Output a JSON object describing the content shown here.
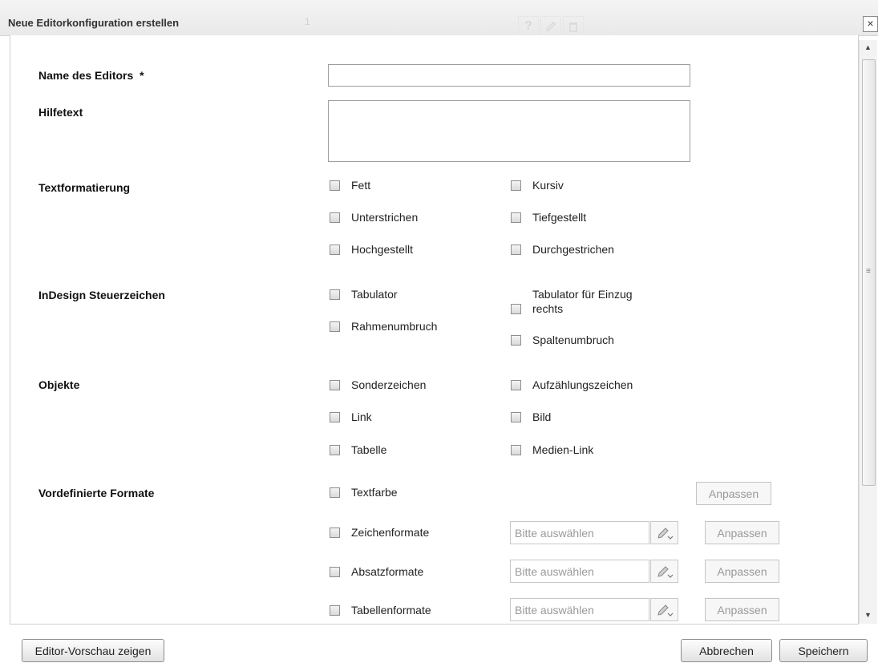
{
  "dialog": {
    "title": "Neue Editorkonfiguration erstellen",
    "bg_number": "1",
    "close_symbol": "×"
  },
  "form": {
    "name_label": "Name des Editors",
    "required_mark": "*",
    "name_value": "",
    "help_label": "Hilfetext",
    "help_value": "",
    "textformat": {
      "label": "Textformatierung",
      "options": [
        "Fett",
        "Kursiv",
        "Unterstrichen",
        "Tiefgestellt",
        "Hochgestellt",
        "Durchgestrichen"
      ]
    },
    "indesign": {
      "label": "InDesign Steuerzeichen",
      "options": [
        "Tabulator",
        "Tabulator für Einzug rechts",
        "Rahmenumbruch",
        "Spaltenumbruch"
      ]
    },
    "objekte": {
      "label": "Objekte",
      "options": [
        "Sonderzeichen",
        "Aufzählungszeichen",
        "Link",
        "Bild",
        "Tabelle",
        "Medien-Link"
      ]
    },
    "formate": {
      "label": "Vordefinierte Formate",
      "textfarbe": "Textfarbe",
      "rows": [
        {
          "label": "Zeichenformate",
          "placeholder": "Bitte auswählen"
        },
        {
          "label": "Absatzformate",
          "placeholder": "Bitte auswählen"
        },
        {
          "label": "Tabellenformate",
          "placeholder": "Bitte auswählen"
        }
      ],
      "adjust_label": "Anpassen"
    }
  },
  "footer": {
    "preview_label": "Editor-Vorschau zeigen",
    "cancel_label": "Abbrechen",
    "save_label": "Speichern"
  },
  "icons": {
    "help": "help-icon",
    "edit": "pencil-icon",
    "delete": "trash-icon",
    "picker": "pencil-dropdown-icon"
  }
}
